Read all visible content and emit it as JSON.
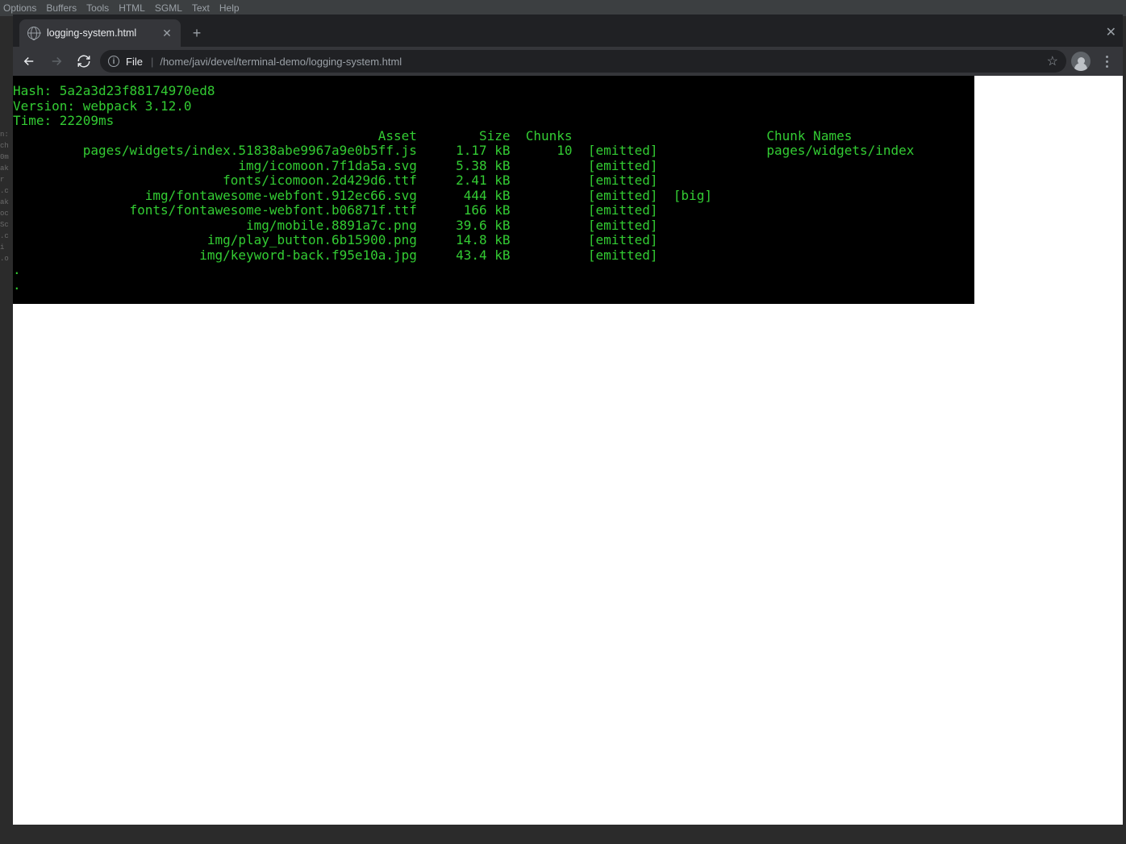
{
  "bgMenu": {
    "items": [
      "Options",
      "Buffers",
      "Tools",
      "HTML",
      "SGML",
      "Text",
      "Help"
    ]
  },
  "bgLeftLines": [
    "n:",
    "ch",
    "0m",
    "ak",
    "",
    "r",
    ".c",
    "ak",
    "",
    "oc",
    "Sc",
    ".c",
    "",
    "i",
    ".o"
  ],
  "browser": {
    "tab": {
      "title": "logging-system.html"
    },
    "addressBar": {
      "scheme": "File",
      "path": "/home/javi/devel/terminal-demo/logging-system.html"
    }
  },
  "terminal": {
    "hashLabel": "Hash:",
    "hash": "5a2a3d23f88174970ed8",
    "versionLabel": "Version:",
    "version": "webpack 3.12.0",
    "timeLabel": "Time:",
    "time": "22209ms",
    "headers": {
      "asset": "Asset",
      "size": "Size",
      "chunks": "Chunks",
      "chunkNames": "Chunk Names"
    },
    "rows": [
      {
        "asset": "pages/widgets/index.51838abe9967a9e0b5ff.js",
        "size": "1.17 kB",
        "chunks": "10",
        "flags": "[emitted]",
        "big": "",
        "chunkName": "pages/widgets/index"
      },
      {
        "asset": "img/icomoon.7f1da5a.svg",
        "size": "5.38 kB",
        "chunks": "",
        "flags": "[emitted]",
        "big": "",
        "chunkName": ""
      },
      {
        "asset": "fonts/icomoon.2d429d6.ttf",
        "size": "2.41 kB",
        "chunks": "",
        "flags": "[emitted]",
        "big": "",
        "chunkName": ""
      },
      {
        "asset": "img/fontawesome-webfont.912ec66.svg",
        "size": "444 kB",
        "chunks": "",
        "flags": "[emitted]",
        "big": "[big]",
        "chunkName": ""
      },
      {
        "asset": "fonts/fontawesome-webfont.b06871f.ttf",
        "size": "166 kB",
        "chunks": "",
        "flags": "[emitted]",
        "big": "",
        "chunkName": ""
      },
      {
        "asset": "img/mobile.8891a7c.png",
        "size": "39.6 kB",
        "chunks": "",
        "flags": "[emitted]",
        "big": "",
        "chunkName": ""
      },
      {
        "asset": "img/play_button.6b15900.png",
        "size": "14.8 kB",
        "chunks": "",
        "flags": "[emitted]",
        "big": "",
        "chunkName": ""
      },
      {
        "asset": "img/keyword-back.f95e10a.jpg",
        "size": "43.4 kB",
        "chunks": "",
        "flags": "[emitted]",
        "big": "",
        "chunkName": ""
      }
    ],
    "trailing": [
      ".",
      "."
    ]
  }
}
